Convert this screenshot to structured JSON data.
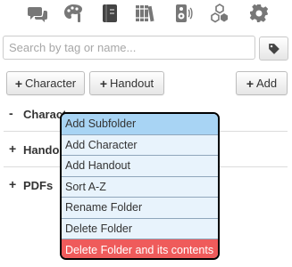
{
  "toolbar": {
    "tabs": [
      {
        "icon": "chat-bubbles-icon"
      },
      {
        "icon": "art-palette-icon"
      },
      {
        "icon": "journal-book-icon"
      },
      {
        "icon": "compendium-books-icon"
      },
      {
        "icon": "jukebox-speaker-icon"
      },
      {
        "icon": "collections-dice-icon"
      },
      {
        "icon": "settings-gear-icon"
      }
    ]
  },
  "search": {
    "placeholder": "Search by tag or name...",
    "value": ""
  },
  "buttons": {
    "character": {
      "plus": "+",
      "label": "Character"
    },
    "handout": {
      "plus": "+",
      "label": "Handout"
    },
    "add": {
      "plus": "+",
      "label": "Add"
    }
  },
  "folders": [
    {
      "toggle": "-",
      "name": "Characters"
    },
    {
      "toggle": "+",
      "name": "Handouts"
    },
    {
      "toggle": "+",
      "name": "PDFs"
    }
  ],
  "context_menu": {
    "items": [
      "Add Subfolder",
      "Add Character",
      "Add Handout",
      "Sort A-Z",
      "Rename Folder",
      "Delete Folder",
      "Delete Folder and its contents"
    ],
    "colors": {
      "item_bg": "#e8f3fc",
      "active_bg": "#a8d4f4",
      "danger_bg": "#ef5b5b"
    }
  }
}
